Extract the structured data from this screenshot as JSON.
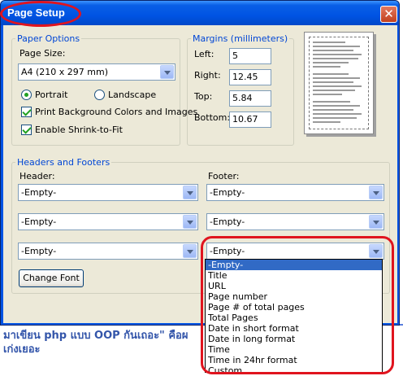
{
  "window": {
    "title": "Page Setup",
    "close_glyph": "✕"
  },
  "background_text": [
    "มาเขียน php แบบ OOP กันเถอะ\" คือผ",
    "เก่งเยอะ"
  ],
  "paper_options": {
    "legend": "Paper Options",
    "page_size_label": "Page Size:",
    "page_size_value": "A4 (210 x 297 mm)",
    "portrait_label": "Portrait",
    "landscape_label": "Landscape",
    "orientation": "Portrait",
    "print_bg_label": "Print Background Colors and Images",
    "print_bg_checked": true,
    "shrink_label": "Enable Shrink-to-Fit",
    "shrink_checked": true
  },
  "margins": {
    "legend": "Margins (millimeters)",
    "left_label": "Left:",
    "left_value": "5",
    "right_label": "Right:",
    "right_value": "12.45",
    "top_label": "Top:",
    "top_value": "5.84",
    "bottom_label": "Bottom:",
    "bottom_value": "10.67"
  },
  "headers_footers": {
    "legend": "Headers and Footers",
    "header_label": "Header:",
    "footer_label": "Footer:",
    "header_values": [
      "-Empty-",
      "-Empty-",
      "-Empty-"
    ],
    "footer_values": [
      "-Empty-",
      "-Empty-",
      "-Empty-"
    ],
    "change_font_label": "Change Font"
  },
  "footer_dropdown_options": [
    "-Empty-",
    "Title",
    "URL",
    "Page number",
    "Page # of total pages",
    "Total Pages",
    "Date in short format",
    "Date in long format",
    "Time",
    "Time in 24hr format",
    "Custom..."
  ],
  "colors": {
    "title_bar": "#0054e3",
    "dialog_bg": "#ece9d8",
    "legend_text": "#0046d5",
    "highlight": "#316ac5",
    "annotation_red": "#e0141e"
  }
}
